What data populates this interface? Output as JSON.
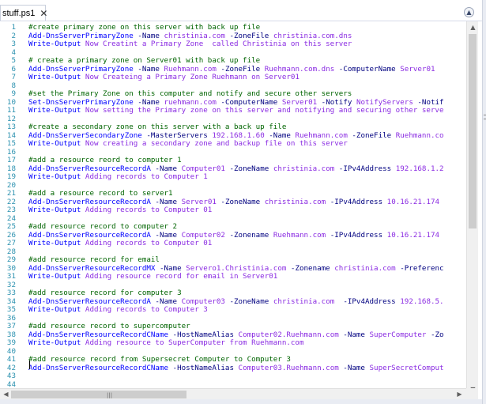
{
  "tab": {
    "title": "stuff.ps1",
    "close": "✕"
  },
  "collapse_icon": "chevron-up-icon",
  "scroll": {
    "up": "▲",
    "down": "▼",
    "left": "◀",
    "right": "▶",
    "grip": "|||"
  },
  "colors": {
    "comment": "#006400",
    "command": "#0000ff",
    "parameter": "#000080",
    "text": "#8a2be2",
    "line_number": "#2b91af"
  },
  "lines": [
    {
      "num": "1",
      "tokens": [
        {
          "t": "comment",
          "v": "#create primary zone on this server with back up file"
        }
      ]
    },
    {
      "num": "2",
      "tokens": [
        {
          "t": "cmd",
          "v": "Add-DnsServerPrimaryZone "
        },
        {
          "t": "param",
          "v": "-Name "
        },
        {
          "t": "text",
          "v": "christinia.com "
        },
        {
          "t": "param",
          "v": "-ZoneFile "
        },
        {
          "t": "text",
          "v": "christinia.com.dns"
        }
      ]
    },
    {
      "num": "3",
      "tokens": [
        {
          "t": "cmd",
          "v": "Write-Output "
        },
        {
          "t": "text",
          "v": "Now Creatint a Primary Zone  called Christinia on this server"
        }
      ]
    },
    {
      "num": "4",
      "tokens": []
    },
    {
      "num": "5",
      "tokens": [
        {
          "t": "comment",
          "v": "# create a primary zone on Server01 with back up file"
        }
      ]
    },
    {
      "num": "6",
      "tokens": [
        {
          "t": "cmd",
          "v": "Add-DnsServerPrimaryZone "
        },
        {
          "t": "param",
          "v": "-Name "
        },
        {
          "t": "text",
          "v": "Ruehmann.com "
        },
        {
          "t": "param",
          "v": "-ZoneFile "
        },
        {
          "t": "text",
          "v": "Ruehmann.com.dns "
        },
        {
          "t": "param",
          "v": "-ComputerName "
        },
        {
          "t": "text",
          "v": "Server01"
        }
      ]
    },
    {
      "num": "7",
      "tokens": [
        {
          "t": "cmd",
          "v": "Write-Output "
        },
        {
          "t": "text",
          "v": "Now Createing a Primary Zone Ruehmann on Server01"
        }
      ]
    },
    {
      "num": "8",
      "tokens": []
    },
    {
      "num": "9",
      "tokens": [
        {
          "t": "comment",
          "v": "#set the Primary Zone on this computer and notify and secure other servers"
        }
      ]
    },
    {
      "num": "10",
      "tokens": [
        {
          "t": "cmd",
          "v": "Set-DnsServerPrimaryZone "
        },
        {
          "t": "param",
          "v": "-Name "
        },
        {
          "t": "text",
          "v": "ruehmann.com "
        },
        {
          "t": "param",
          "v": "-ComputerName "
        },
        {
          "t": "text",
          "v": "Server01 "
        },
        {
          "t": "param",
          "v": "-Notify "
        },
        {
          "t": "text",
          "v": "NotifyServers "
        },
        {
          "t": "param",
          "v": "-Notif"
        }
      ]
    },
    {
      "num": "11",
      "tokens": [
        {
          "t": "cmd",
          "v": "Write-Output "
        },
        {
          "t": "text",
          "v": "Now setting the Primary zone on this server and notifying and securing other serve"
        }
      ]
    },
    {
      "num": "12",
      "tokens": []
    },
    {
      "num": "13",
      "tokens": [
        {
          "t": "comment",
          "v": "#create a secondary zone on this server with a back up file"
        }
      ]
    },
    {
      "num": "14",
      "tokens": [
        {
          "t": "cmd",
          "v": "Add-DnsServerSecondaryZone "
        },
        {
          "t": "param",
          "v": "-MasterServers "
        },
        {
          "t": "text",
          "v": "192.168.1.60 "
        },
        {
          "t": "param",
          "v": "-Name "
        },
        {
          "t": "text",
          "v": "Ruehmann.com "
        },
        {
          "t": "param",
          "v": "-ZoneFile "
        },
        {
          "t": "text",
          "v": "Ruehmann.co"
        }
      ]
    },
    {
      "num": "15",
      "tokens": [
        {
          "t": "cmd",
          "v": "Write-Output "
        },
        {
          "t": "text",
          "v": "Now creating a secondary zone and backup file on this server"
        }
      ]
    },
    {
      "num": "16",
      "tokens": []
    },
    {
      "num": "17",
      "tokens": [
        {
          "t": "comment",
          "v": "#add a resource reord to computer 1"
        }
      ]
    },
    {
      "num": "18",
      "tokens": [
        {
          "t": "cmd",
          "v": "Add-DnsServerResourceRecordA "
        },
        {
          "t": "param",
          "v": "-Name "
        },
        {
          "t": "text",
          "v": "Computer01 "
        },
        {
          "t": "param",
          "v": "-ZoneName "
        },
        {
          "t": "text",
          "v": "christinia.com "
        },
        {
          "t": "param",
          "v": "-IPv4Address "
        },
        {
          "t": "text",
          "v": "192.168.1.2"
        }
      ]
    },
    {
      "num": "19",
      "tokens": [
        {
          "t": "cmd",
          "v": "Write-Output "
        },
        {
          "t": "text",
          "v": "Adding records to Computer 1"
        }
      ]
    },
    {
      "num": "20",
      "tokens": []
    },
    {
      "num": "21",
      "tokens": [
        {
          "t": "comment",
          "v": "#add a resource record to server1"
        }
      ]
    },
    {
      "num": "22",
      "tokens": [
        {
          "t": "cmd",
          "v": "Add-DnsServerResourceRecordA "
        },
        {
          "t": "param",
          "v": "-Name "
        },
        {
          "t": "text",
          "v": "Server01 "
        },
        {
          "t": "param",
          "v": "-ZoneName "
        },
        {
          "t": "text",
          "v": "christinia.com "
        },
        {
          "t": "param",
          "v": "-IPv4Address "
        },
        {
          "t": "text",
          "v": "10.16.21.174"
        }
      ]
    },
    {
      "num": "23",
      "tokens": [
        {
          "t": "cmd",
          "v": "Write-Output "
        },
        {
          "t": "text",
          "v": "Adding records to Computer 01"
        }
      ]
    },
    {
      "num": "24",
      "tokens": []
    },
    {
      "num": "25",
      "tokens": [
        {
          "t": "comment",
          "v": "#add resource record to computer 2"
        }
      ]
    },
    {
      "num": "26",
      "tokens": [
        {
          "t": "cmd",
          "v": "Add-DnsServerResourceRecordA "
        },
        {
          "t": "param",
          "v": "-Name "
        },
        {
          "t": "text",
          "v": "Computer02 "
        },
        {
          "t": "param",
          "v": "-Zonename "
        },
        {
          "t": "text",
          "v": "Ruehmann.com "
        },
        {
          "t": "param",
          "v": "-IPv4Address "
        },
        {
          "t": "text",
          "v": "10.16.21.174"
        }
      ]
    },
    {
      "num": "27",
      "tokens": [
        {
          "t": "cmd",
          "v": "Write-Output "
        },
        {
          "t": "text",
          "v": "Adding records to Computer 01"
        }
      ]
    },
    {
      "num": "28",
      "tokens": []
    },
    {
      "num": "29",
      "tokens": [
        {
          "t": "comment",
          "v": "#add resource record for email"
        }
      ]
    },
    {
      "num": "30",
      "tokens": [
        {
          "t": "cmd",
          "v": "Add-DnsServerResourceRecordMX "
        },
        {
          "t": "param",
          "v": "-Name "
        },
        {
          "t": "text",
          "v": "Servero1.Christinia.com "
        },
        {
          "t": "param",
          "v": "-Zonename "
        },
        {
          "t": "text",
          "v": "christinia.com "
        },
        {
          "t": "param",
          "v": "-Preferenc"
        }
      ]
    },
    {
      "num": "31",
      "tokens": [
        {
          "t": "cmd",
          "v": "Write-Output "
        },
        {
          "t": "text",
          "v": "Adding resource record for email in Server01"
        }
      ]
    },
    {
      "num": "32",
      "tokens": []
    },
    {
      "num": "33",
      "tokens": [
        {
          "t": "comment",
          "v": "#add resource record for computer 3"
        }
      ]
    },
    {
      "num": "34",
      "tokens": [
        {
          "t": "cmd",
          "v": "Add-DnsServerResourceRecordA "
        },
        {
          "t": "param",
          "v": "-Name "
        },
        {
          "t": "text",
          "v": "Computer03 "
        },
        {
          "t": "param",
          "v": "-ZoneName "
        },
        {
          "t": "text",
          "v": "christinia.com  "
        },
        {
          "t": "param",
          "v": "-IPv4Address "
        },
        {
          "t": "text",
          "v": "192.168.5."
        }
      ]
    },
    {
      "num": "35",
      "tokens": [
        {
          "t": "cmd",
          "v": "Write-Output "
        },
        {
          "t": "text",
          "v": "Adding records to Computer 3"
        }
      ]
    },
    {
      "num": "36",
      "tokens": []
    },
    {
      "num": "37",
      "tokens": [
        {
          "t": "comment",
          "v": "#add resource record to supercomputer"
        }
      ]
    },
    {
      "num": "38",
      "tokens": [
        {
          "t": "cmd",
          "v": "Add-DnsServerResourceRecordCName "
        },
        {
          "t": "param",
          "v": "-HostNameAlias "
        },
        {
          "t": "text",
          "v": "Computer02.Ruehmann.com "
        },
        {
          "t": "param",
          "v": "-Name "
        },
        {
          "t": "text",
          "v": "SuperComputer "
        },
        {
          "t": "param",
          "v": "-Zo"
        }
      ]
    },
    {
      "num": "39",
      "tokens": [
        {
          "t": "cmd",
          "v": "Write-Output "
        },
        {
          "t": "text",
          "v": "Adding resource to SuperComputer from Ruehmann.com"
        }
      ]
    },
    {
      "num": "40",
      "tokens": []
    },
    {
      "num": "41",
      "tokens": [
        {
          "t": "comment",
          "v": "#add resource record from Supersecret Computer to Computer 3"
        }
      ]
    },
    {
      "num": "42",
      "tokens": [
        {
          "t": "cmd",
          "v": "Add-DnsServerResourceRecordCName "
        },
        {
          "t": "param",
          "v": "-HostNameAlias "
        },
        {
          "t": "text",
          "v": "Computer03.Ruehmann.com "
        },
        {
          "t": "param",
          "v": "-Name "
        },
        {
          "t": "text",
          "v": "SuperSecretComput"
        }
      ]
    },
    {
      "num": "43",
      "tokens": []
    },
    {
      "num": "44",
      "tokens": []
    }
  ]
}
